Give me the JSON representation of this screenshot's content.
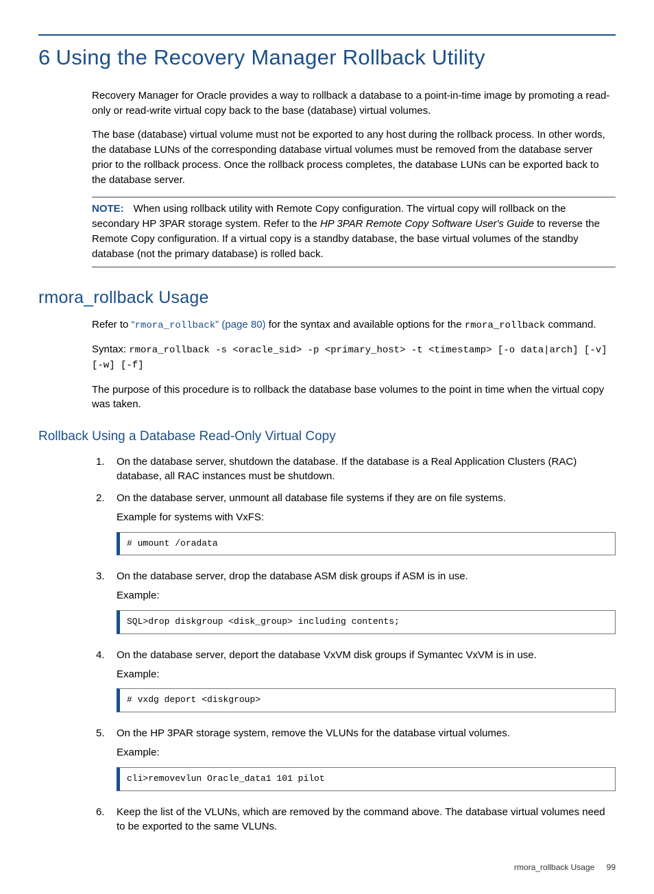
{
  "chapter_number": "6",
  "chapter_title": "Using the Recovery Manager Rollback Utility",
  "intro": {
    "p1": "Recovery Manager for Oracle provides a way to rollback a database to a point-in-time image by promoting a read-only or read-write virtual copy back to the base (database) virtual volumes.",
    "p2": "The base (database) virtual volume must not be exported to any host during the rollback process. In other words, the database LUNs of the corresponding database virtual volumes must be removed from the database server prior to the rollback process. Once the rollback process completes, the database LUNs can be exported back to the database server."
  },
  "note": {
    "label": "NOTE:",
    "text_a": "When using rollback utility with Remote Copy configuration. The virtual copy will rollback on the secondary HP 3PAR storage system. Refer to the ",
    "text_em": "HP 3PAR Remote Copy Software User's Guide",
    "text_b": " to reverse the Remote Copy configuration. If a virtual copy is a standby database, the base virtual volumes of the standby database (not the primary database) is rolled back."
  },
  "section1": {
    "title": "rmora_rollback Usage",
    "refer_a": "Refer to ",
    "refer_q1": "“",
    "refer_link": "rmora_rollback",
    "refer_q2": "” (page 80)",
    "refer_b": " for the syntax and available options for the ",
    "refer_cmd": "rmora_rollback",
    "refer_c": " command.",
    "syntax_label": "Syntax: ",
    "syntax_code": "rmora_rollback -s <oracle_sid> -p <primary_host> -t <timestamp> [-o data|arch] [-v] [-w] [-f]",
    "purpose": "The purpose of this procedure is to rollback the database base volumes to the point in time when the virtual copy was taken."
  },
  "section2": {
    "title": "Rollback Using a Database Read-Only Virtual Copy",
    "steps": [
      {
        "text": "On the database server, shutdown the database. If the database is a Real Application Clusters (RAC) database, all RAC instances must be shutdown."
      },
      {
        "text": "On the database server, unmount all database file systems if they are on file systems.",
        "sub": "Example for systems with VxFS:",
        "code": "# umount /oradata"
      },
      {
        "text": "On the database server, drop the database ASM disk groups if ASM is in use.",
        "sub": "Example:",
        "code": "SQL>drop diskgroup <disk_group> including contents;"
      },
      {
        "text": "On the database server, deport the database VxVM disk groups if Symantec VxVM is in use.",
        "sub": "Example:",
        "code": "# vxdg deport <diskgroup>"
      },
      {
        "text": "On the HP 3PAR storage system, remove the VLUNs for the database virtual volumes.",
        "sub": "Example:",
        "code": "cli>removevlun Oracle_data1 101 pilot"
      },
      {
        "text": "Keep the list of the VLUNs, which are removed by the command above. The database virtual volumes need to be exported to the same VLUNs."
      }
    ]
  },
  "footer": {
    "section": "rmora_rollback Usage",
    "page": "99"
  }
}
